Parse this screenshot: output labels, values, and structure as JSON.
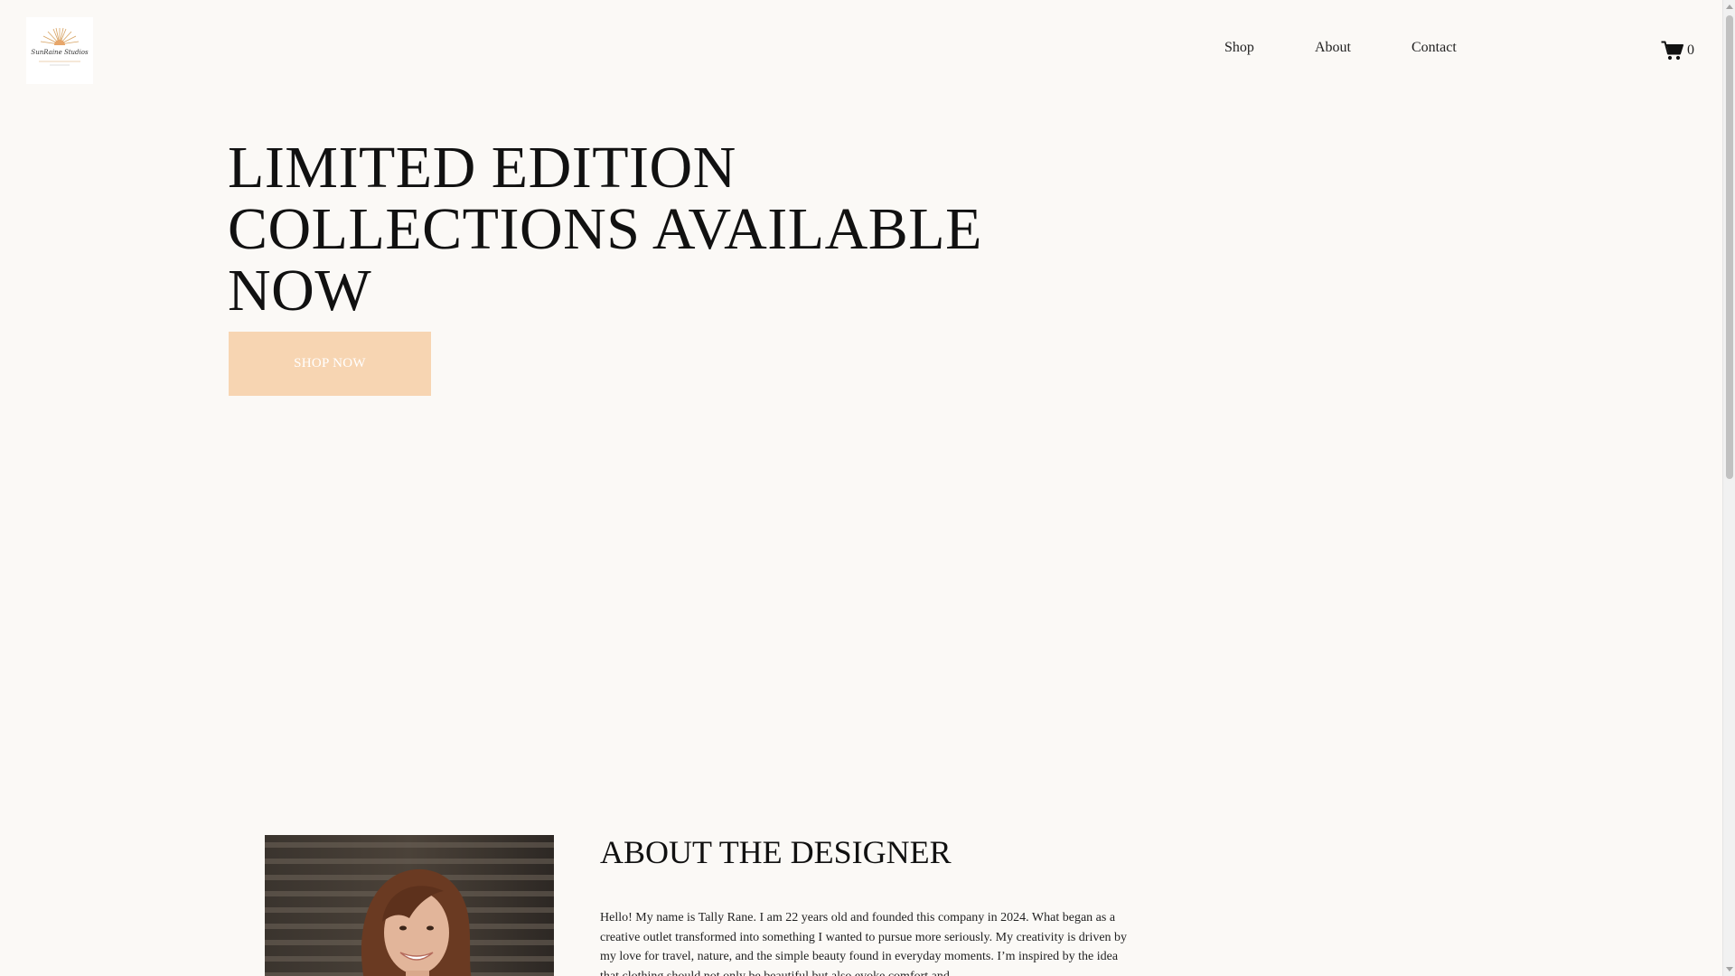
{
  "header": {
    "logo_text": "SunRaine Studios",
    "nav": {
      "shop": "Shop",
      "about": "About",
      "contact": "Contact"
    },
    "cart": {
      "icon": "cart-icon",
      "count": "0"
    }
  },
  "hero": {
    "title_line1": "LIMITED EDITION",
    "title_line2": "COLLECTIONS AVAILABLE",
    "title_line3": "NOW",
    "button_label": "SHOP NOW",
    "button_color": "#f7d5b2"
  },
  "about": {
    "title": "ABOUT THE DESIGNER",
    "text": "Hello! My name is Tally Rane. I am 22 years old and founded this company in 2024. What began as a creative outlet transformed into something I wanted to pursue more seriously. My creativity is driven by my love for travel, nature, and the simple beauty found in everyday moments. I’m inspired by the idea that clothing should not only be beautiful but also evoke comfort and"
  },
  "colors": {
    "background": "#fbf9f6",
    "accent": "#f7d5b2",
    "text": "#111111"
  }
}
